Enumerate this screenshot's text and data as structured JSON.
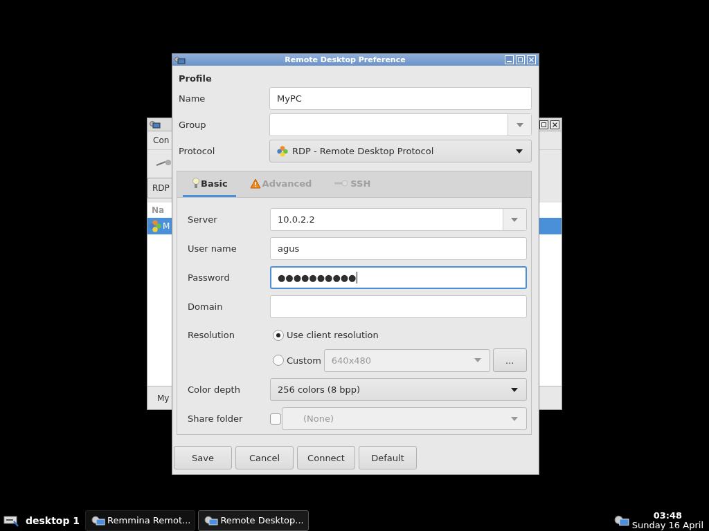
{
  "background_window": {
    "menu_fragment": "Con",
    "button_fragment": "RDP",
    "column_fragment": "Na",
    "row": {
      "text": "M",
      "selected": true
    },
    "status_fragment": "My"
  },
  "dialog": {
    "title": "Remote Desktop Preference",
    "section": "Profile",
    "profile_fields": [
      {
        "label": "Name",
        "kind": "text",
        "value": "MyPC"
      },
      {
        "label": "Group",
        "kind": "combo"
      },
      {
        "label": "Protocol",
        "kind": "dropdown",
        "value": "RDP - Remote Desktop Protocol"
      }
    ],
    "tabs": [
      {
        "label": "Basic",
        "selected": true
      },
      {
        "label": "Advanced",
        "selected": false
      },
      {
        "label": "SSH",
        "selected": false
      }
    ],
    "basic_fields": [
      {
        "label": "Server",
        "kind": "combo",
        "value": "10.0.2.2",
        "focused": false
      },
      {
        "label": "User name",
        "kind": "text",
        "value": "agus",
        "focused": false
      },
      {
        "label": "Password",
        "kind": "text",
        "value": "●●●●●●●●●●",
        "focused": true
      },
      {
        "label": "Domain",
        "kind": "text",
        "focused": false
      }
    ],
    "resolution": {
      "label": "Resolution",
      "options": [
        {
          "label": "Use client resolution",
          "selected": true
        },
        {
          "label": "Custom",
          "selected": false,
          "value": "640x480",
          "button": "..."
        }
      ]
    },
    "color_depth": {
      "label": "Color depth",
      "value": "256 colors (8 bpp)"
    },
    "share_folder": {
      "label": "Share folder",
      "checked": false,
      "value": "(None)"
    },
    "buttons": [
      "Save",
      "Cancel",
      "Connect",
      "Default"
    ]
  },
  "taskbar": {
    "workspace": "desktop 1",
    "tasks": [
      {
        "label": "Remmina Remot...",
        "selected": false
      },
      {
        "label": "Remote Desktop...",
        "selected": true
      }
    ],
    "clock": {
      "time": "03:48",
      "date": "Sunday 16 April"
    }
  }
}
